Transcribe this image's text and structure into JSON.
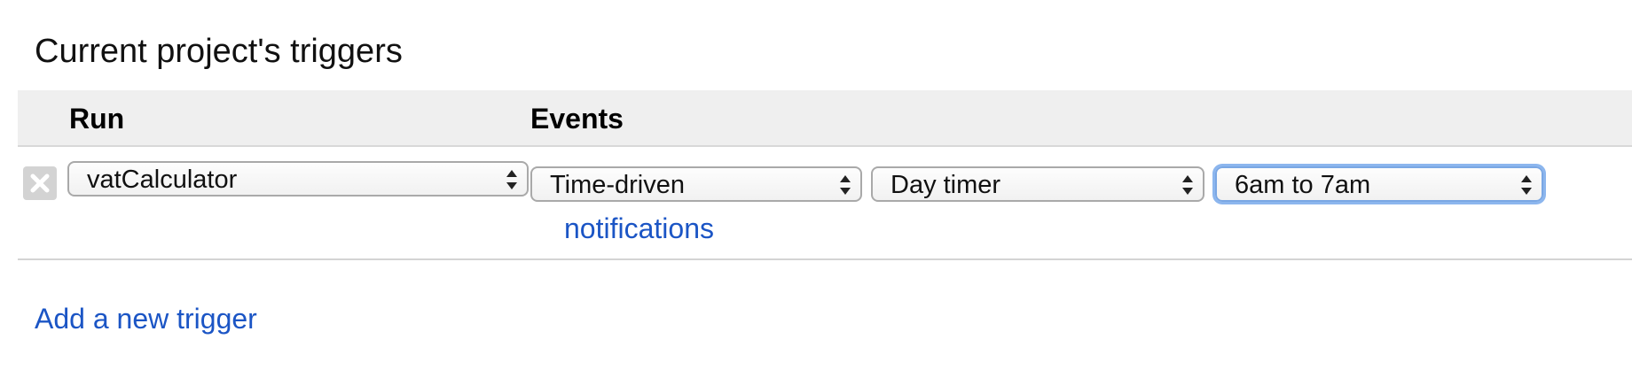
{
  "page": {
    "title": "Current project's triggers"
  },
  "table": {
    "headers": {
      "run": "Run",
      "events": "Events"
    },
    "rows": [
      {
        "run_function": "vatCalculator",
        "event_source": "Time-driven",
        "timer_type": "Day timer",
        "time_of_day": "6am to 7am",
        "notifications_label": "notifications"
      }
    ]
  },
  "actions": {
    "add_trigger_label": "Add a new trigger"
  },
  "icons": {
    "delete": "close-icon",
    "select_arrows": "updown-arrows-icon"
  },
  "colors": {
    "link": "#1b55c5",
    "header_bg": "#efefef",
    "focus_ring": "#8cb6ee"
  }
}
